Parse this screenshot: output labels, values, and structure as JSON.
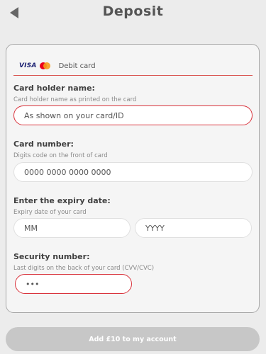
{
  "header": {
    "title": "Deposit",
    "back_icon": "back-arrow-icon"
  },
  "payment_method": {
    "brand_visa": "VISA",
    "brand_mastercard_icon": "mastercard-icon",
    "label": "Debit card"
  },
  "form": {
    "holder": {
      "label": "Card holder name:",
      "hint": "Card holder name as printed on the card",
      "placeholder": "As shown on your card/ID",
      "value": ""
    },
    "number": {
      "label": "Card number:",
      "hint": "Digits code on the front of card",
      "placeholder": "0000 0000 0000 0000",
      "value": ""
    },
    "expiry": {
      "label": "Enter the expiry date:",
      "hint": "Expiry date of your card",
      "month_placeholder": "MM",
      "year_placeholder": "YYYY"
    },
    "security": {
      "label": "Security number:",
      "hint": "Last digits on the back of your card (CVV/CVC)",
      "placeholder": "•••",
      "value": ""
    }
  },
  "submit": {
    "label": "Add £10 to my account"
  },
  "colors": {
    "accent_error": "#d9333c",
    "divider": "#d9534f",
    "button_disabled": "#c7c7c7"
  }
}
